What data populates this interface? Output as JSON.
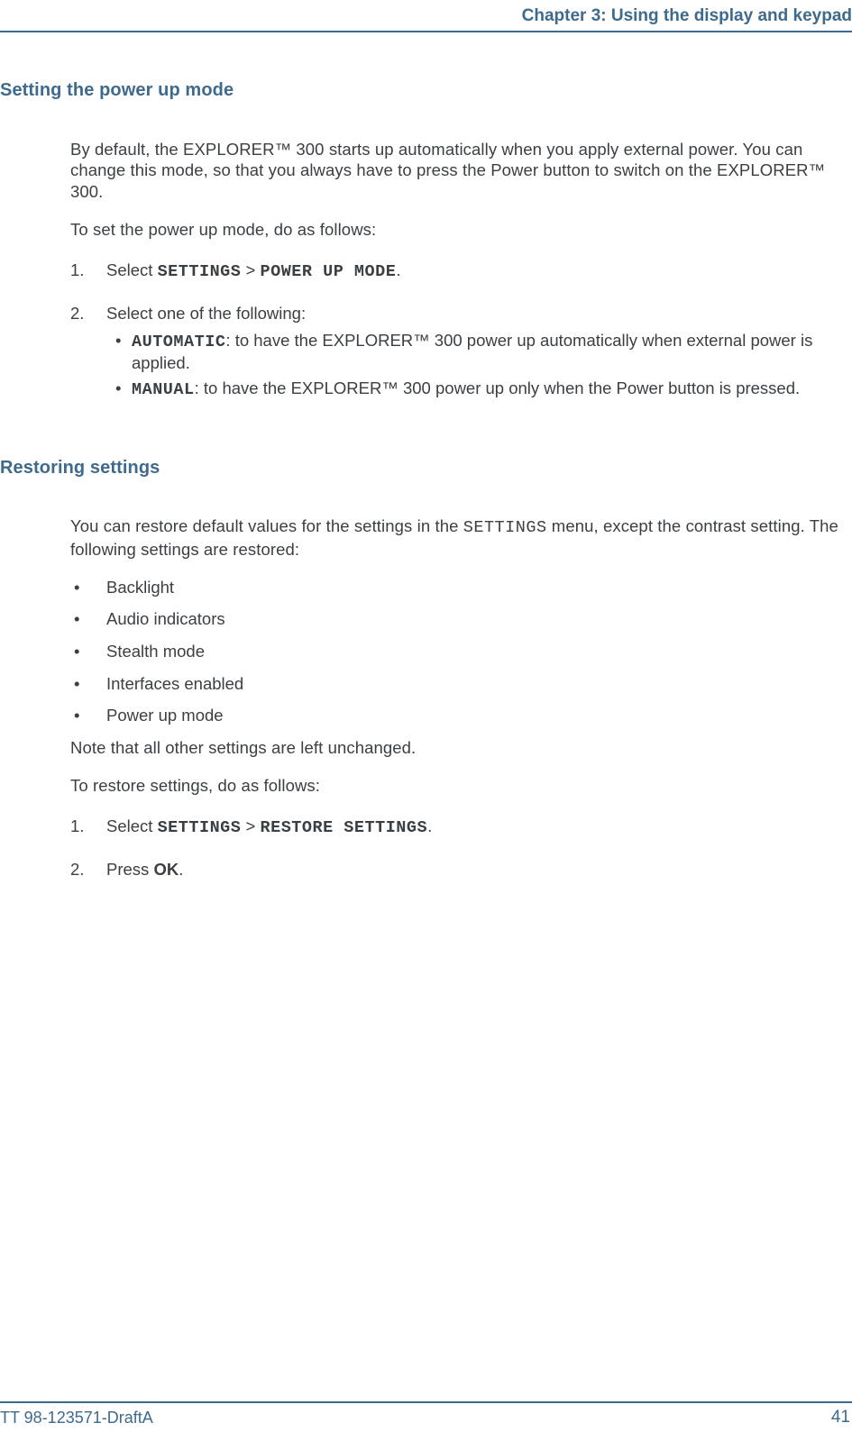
{
  "header": {
    "chapter_title": "Chapter 3: Using the display and keypad"
  },
  "section1": {
    "heading": "Setting the power up mode",
    "p1": "By default, the EXPLORER™ 300 starts up automatically when you apply external power. You can change this mode, so that you always have to press the Power button to switch on the EXPLORER™ 300.",
    "p2": "To set the power up mode, do as follows:",
    "step1": {
      "num": "1.",
      "lead": "Select ",
      "code1": "SETTINGS",
      "sep": " > ",
      "code2": "POWER UP MODE",
      "tail": "."
    },
    "step2": {
      "num": "2.",
      "intro": "Select one of the following:",
      "bullets": [
        {
          "code": "AUTOMATIC",
          "rest": ": to have the EXPLORER™ 300 power up automatically when external power is applied."
        },
        {
          "code": "MANUAL",
          "rest": ": to have the EXPLORER™ 300 power up only when the Power button is pressed."
        }
      ]
    }
  },
  "section2": {
    "heading": "Restoring settings",
    "p1_a": "You can restore default values for the settings in the ",
    "p1_code": "SETTINGS",
    "p1_b": " menu, except the contrast setting. The following settings are restored:",
    "bullets": [
      "Backlight",
      "Audio indicators",
      "Stealth mode",
      "Interfaces enabled",
      "Power up mode"
    ],
    "p2": "Note that all other settings are left unchanged.",
    "p3": "To restore settings, do as follows:",
    "step1": {
      "num": "1.",
      "lead": "Select ",
      "code1": "SETTINGS",
      "sep": " > ",
      "code2": "RESTORE SETTINGS",
      "tail": "."
    },
    "step2": {
      "num": "2.",
      "lead": "Press ",
      "bold": "OK",
      "tail": "."
    }
  },
  "footer": {
    "left": "TT 98-123571-DraftA",
    "right": "41"
  }
}
